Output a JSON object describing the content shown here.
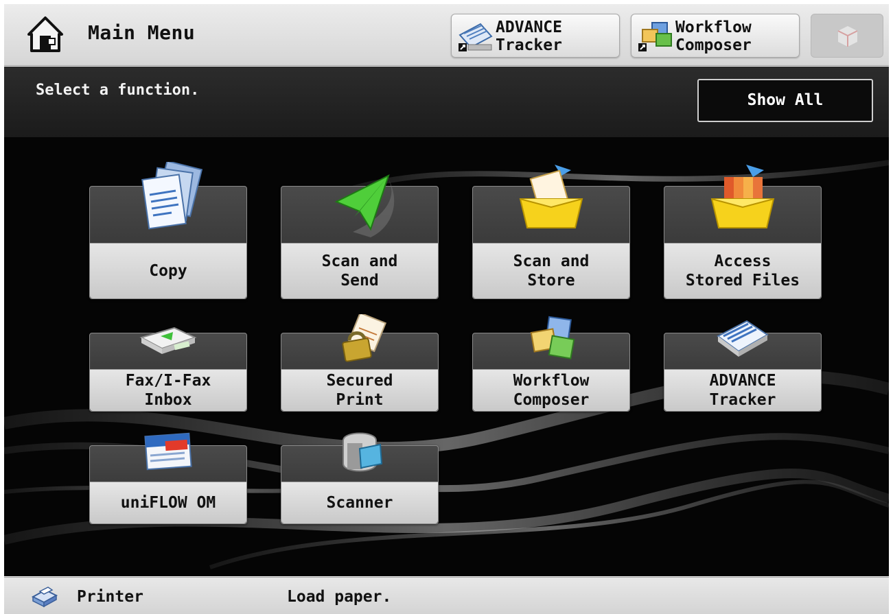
{
  "header": {
    "title": "Main Menu",
    "shortcut_advance": "ADVANCE\nTracker",
    "shortcut_workflow": "Workflow\nComposer"
  },
  "main": {
    "message": "Select a function.",
    "show_all_label": "Show All",
    "tiles": [
      {
        "label": "Copy",
        "icon": "copy-icon"
      },
      {
        "label": "Scan and\nSend",
        "icon": "paper-plane-icon"
      },
      {
        "label": "Scan and\nStore",
        "icon": "store-box-icon"
      },
      {
        "label": "Access\nStored Files",
        "icon": "stored-files-icon"
      },
      {
        "label": "Fax/I-Fax\nInbox",
        "icon": "fax-inbox-icon"
      },
      {
        "label": "Secured\nPrint",
        "icon": "secured-print-icon"
      },
      {
        "label": "Workflow\nComposer",
        "icon": "workflow-composer-icon"
      },
      {
        "label": "ADVANCE\nTracker",
        "icon": "advance-tracker-icon"
      },
      {
        "label": "uniFLOW OM",
        "icon": "uniflow-icon"
      },
      {
        "label": "Scanner",
        "icon": "scanner-icon"
      }
    ]
  },
  "status": {
    "device": "Printer",
    "message": "Load paper."
  },
  "colors": {
    "background": "#050505",
    "label_area": "#d8d8d8",
    "header": "#e0e0e0"
  }
}
